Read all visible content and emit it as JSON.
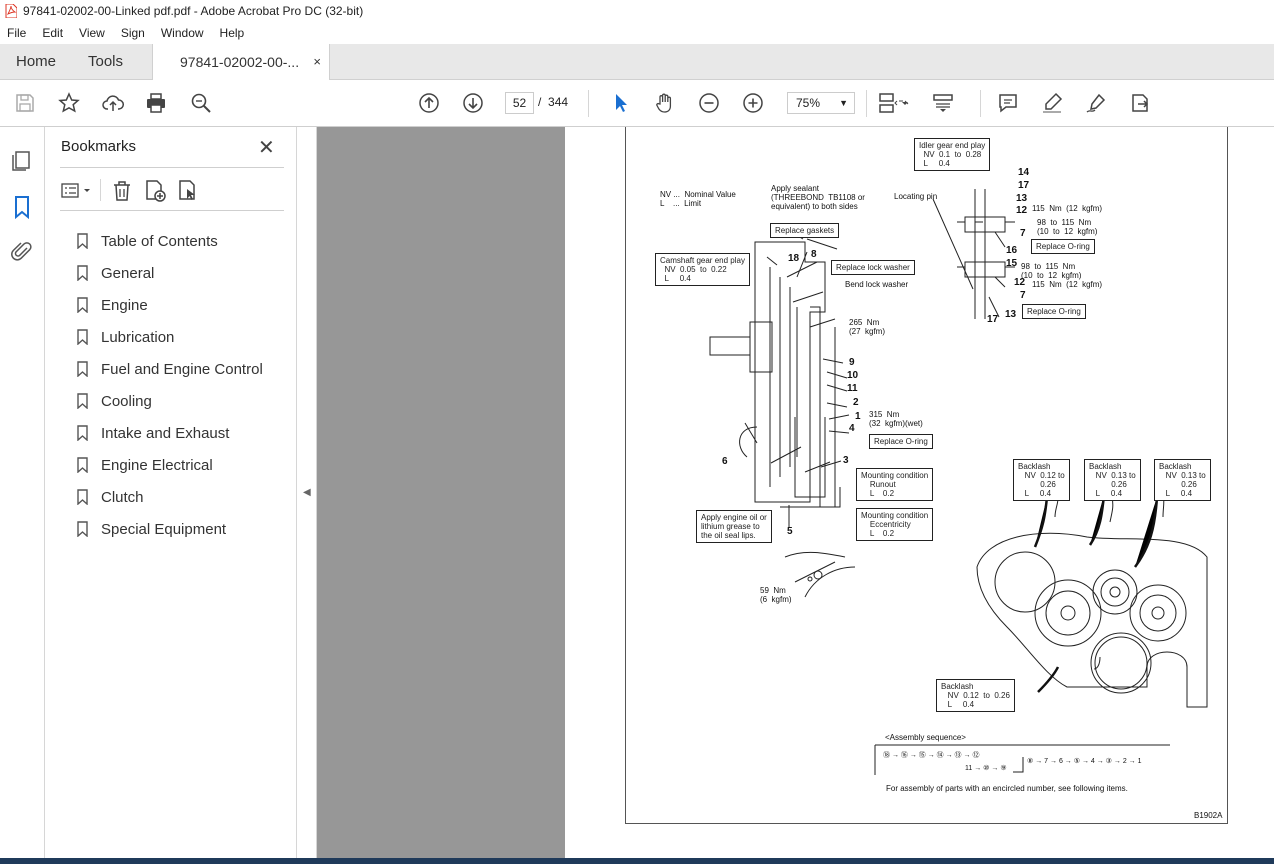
{
  "window": {
    "title": "97841-02002-00-Linked pdf.pdf - Adobe Acrobat Pro DC (32-bit)"
  },
  "menu": [
    "File",
    "Edit",
    "View",
    "Sign",
    "Window",
    "Help"
  ],
  "tabs": {
    "home": "Home",
    "tools": "Tools",
    "document": "97841-02002-00-...",
    "close": "×"
  },
  "toolbar": {
    "current_page": "52",
    "page_separator": "/",
    "total_pages": "344",
    "zoom": "75%"
  },
  "bookmarks": {
    "title": "Bookmarks",
    "items": [
      "Table of Contents",
      "General",
      "Engine",
      "Lubrication",
      "Fuel and Engine Control",
      "Cooling",
      "Intake and Exhaust",
      "Engine Electrical",
      "Clutch",
      "Special Equipment"
    ]
  },
  "drawing": {
    "idler_play": "Idler gear end play\n  NV  0.1  to  0.28\n  L     0.4",
    "legend": "NV ...  Nominal Value\nL    ...  Limit",
    "sealant": "Apply sealant\n(THREEBOND  TB1108 or\nequivalent) to both sides",
    "locating_pin": "Locating pin",
    "replace_gaskets": "Replace gaskets",
    "camshaft_play": "Camshaft gear end play\n  NV  0.05  to  0.22\n  L     0.4",
    "replace_lock_washer": "Replace lock washer",
    "bend_lock_washer": "Bend lock washer",
    "torque_265": "265  Nm\n(27  kgfm)",
    "torque_315": "315  Nm\n(32  kgfm)(wet)",
    "replace_oring_1": "Replace O-ring",
    "replace_oring_2": "Replace O-ring",
    "replace_oring_3": "Replace O-ring",
    "torque_115_a": "115  Nm  (12  kgfm)",
    "torque_98_a": "98  to  115  Nm\n(10  to  12  kgfm)",
    "torque_98_b": "98  to  115  Nm\n(10  to  12  kgfm)",
    "torque_115_b": "115  Nm  (12  kgfm)",
    "mount_runout": "Mounting condition\n    Runout\n    L    0.2",
    "mount_ecc": "Mounting condition\n    Eccentricity\n    L    0.2",
    "apply_oil": "Apply engine oil or\nlithium grease to\nthe oil seal lips.",
    "torque_59": "59  Nm\n(6  kgfm)",
    "backlash_1": "Backlash\n   NV  0.12 to\n          0.26\n   L     0.4",
    "backlash_2": "Backlash\n   NV  0.13 to\n          0.26\n   L     0.4",
    "backlash_3": "Backlash\n   NV  0.13 to\n          0.26\n   L     0.4",
    "backlash_4": "Backlash\n   NV  0.12  to  0.26\n   L     0.4",
    "assembly_title": "<Assembly sequence>",
    "assembly_row1": "⑱ → ⑯ → ⑮ → ⑭ → ⑬ → ⑫",
    "assembly_row2": "11 → ⑩ → ⑨",
    "assembly_tail": "⑧ → 7 → 6 → ⑤ → 4 → ③ → 2 → 1",
    "assembly_note": "For assembly of parts with an encircled number, see following items.",
    "fig_id": "B1902A",
    "numbers": [
      "14",
      "17",
      "13",
      "12",
      "7",
      "16",
      "15",
      "12",
      "7",
      "17",
      "13",
      "18",
      "8",
      "9",
      "10",
      "11",
      "2",
      "1",
      "4",
      "6",
      "3",
      "5"
    ]
  }
}
